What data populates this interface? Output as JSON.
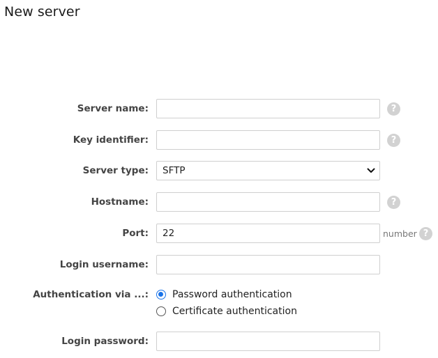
{
  "page": {
    "title": "New server"
  },
  "form": {
    "server_name": {
      "label": "Server name:",
      "value": "",
      "placeholder": ""
    },
    "key_identifier": {
      "label": "Key identifier:",
      "value": "",
      "placeholder": ""
    },
    "server_type": {
      "label": "Server type:",
      "selected": "SFTP"
    },
    "hostname": {
      "label": "Hostname:",
      "value": "",
      "placeholder": ""
    },
    "port": {
      "label": "Port:",
      "value": "22",
      "unit": "number"
    },
    "login_username": {
      "label": "Login username:",
      "value": ""
    },
    "authentication": {
      "label": "Authentication via ...:",
      "options": [
        {
          "label": "Password authentication",
          "checked": true
        },
        {
          "label": "Certificate authentication",
          "checked": false
        }
      ]
    },
    "login_password": {
      "label": "Login password:",
      "value": ""
    }
  },
  "icons": {
    "help": "question-mark-circle-icon",
    "help_glyph": "?",
    "dropdown": "chevron-down-icon"
  },
  "colors": {
    "accent": "#1a73e8",
    "help_icon_bg": "#d2d2d2",
    "input_border": "#cfcfcf",
    "label_text": "#444444"
  }
}
